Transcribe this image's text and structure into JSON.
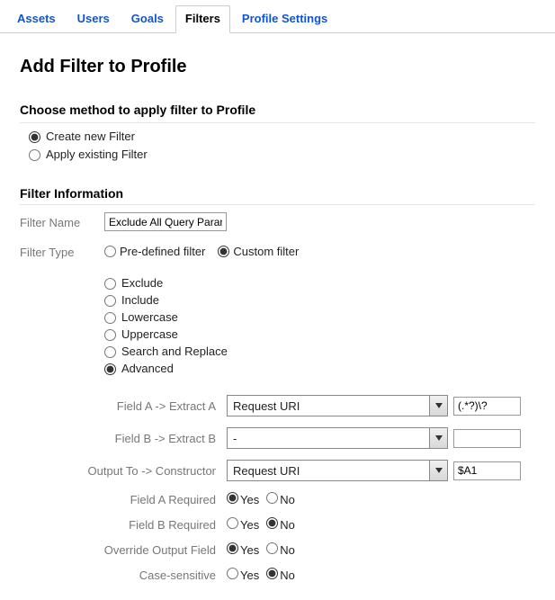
{
  "tabs": {
    "items": [
      "Assets",
      "Users",
      "Goals",
      "Filters",
      "Profile Settings"
    ],
    "activeIndex": 3
  },
  "page": {
    "title": "Add Filter to Profile"
  },
  "method": {
    "heading": "Choose method to apply filter to Profile",
    "options": {
      "create": "Create new Filter",
      "existing": "Apply existing Filter"
    },
    "selected": "create"
  },
  "info": {
    "heading": "Filter Information",
    "name_label": "Filter Name",
    "name_value": "Exclude All Query Parameters",
    "type_label": "Filter Type",
    "type_options": {
      "predefined": "Pre-defined filter",
      "custom": "Custom filter"
    },
    "type_selected": "custom",
    "subtype_options": {
      "exclude": "Exclude",
      "include": "Include",
      "lowercase": "Lowercase",
      "uppercase": "Uppercase",
      "search_replace": "Search and Replace",
      "advanced": "Advanced"
    },
    "subtype_selected": "advanced"
  },
  "advanced": {
    "fieldA_label": "Field A -> Extract A",
    "fieldA_select": "Request URI",
    "fieldA_value": "(.*?)\\?",
    "fieldB_label": "Field B -> Extract B",
    "fieldB_select": "-",
    "fieldB_value": "",
    "output_label": "Output To -> Constructor",
    "output_select": "Request URI",
    "output_value": "$A1",
    "req_a_label": "Field A Required",
    "req_b_label": "Field B Required",
    "override_label": "Override Output Field",
    "case_label": "Case-sensitive",
    "yes": "Yes",
    "no": "No",
    "req_a_selected": "yes",
    "req_b_selected": "no",
    "override_selected": "yes",
    "case_selected": "no"
  }
}
